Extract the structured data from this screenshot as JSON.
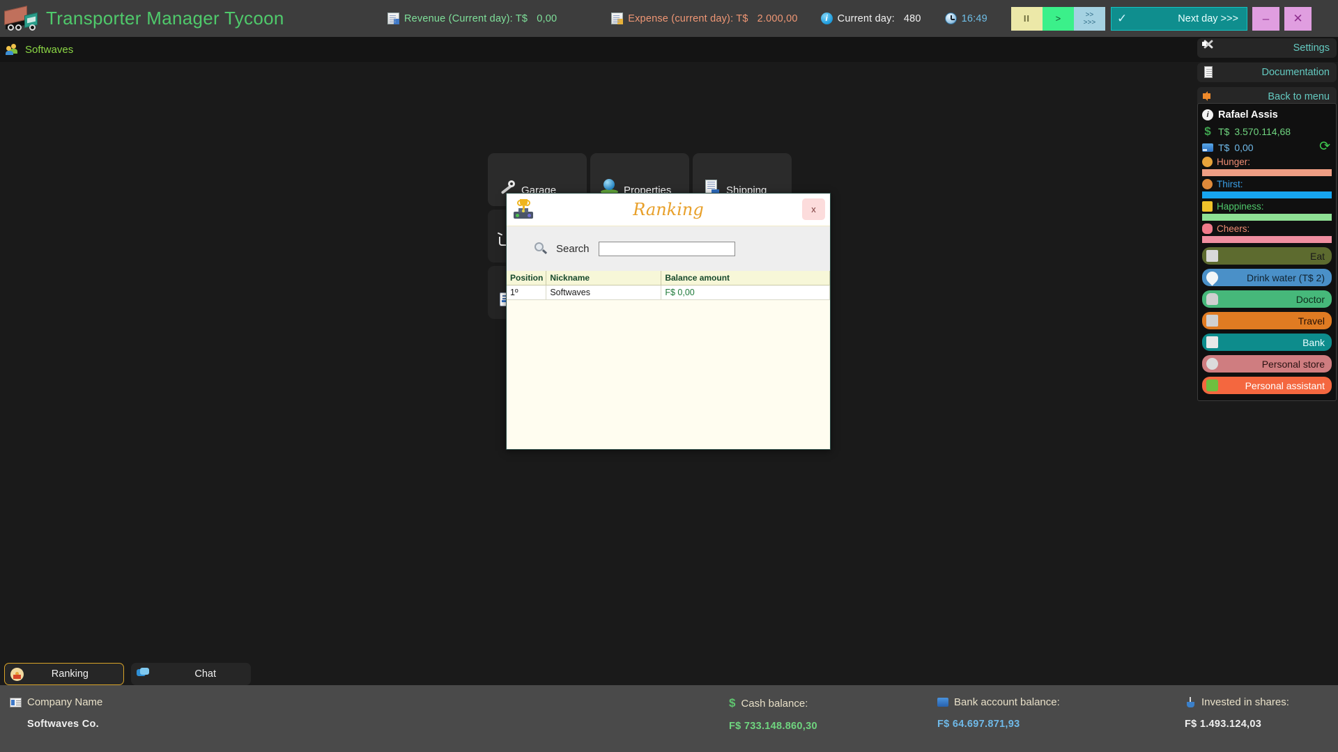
{
  "topbar": {
    "app_title": "Transporter Manager Tycoon",
    "revenue_label": "Revenue (Current day): T$",
    "revenue_value": "0,00",
    "expense_label": "Expense (current day): T$",
    "expense_value": "2.000,00",
    "current_day_label": "Current day:",
    "current_day_value": "480",
    "clock_value": "16:49",
    "pause_label": "II",
    "play_label": ">",
    "ff_label_1": ">>",
    "ff_label_2": ">>>",
    "next_day_label": "Next day >>>",
    "next_day_check": "✓",
    "minimize_label": "–",
    "close_label": "✕"
  },
  "playerbar": {
    "nickname": "Softwaves"
  },
  "cards": [
    {
      "label": "Garage",
      "icon": "wrench-icon"
    },
    {
      "label": "Properties",
      "icon": "globe-icon"
    },
    {
      "label": "Shipping",
      "icon": "shipping-doc-icon"
    },
    {
      "label": "",
      "icon": "cart-icon"
    },
    {
      "label": "",
      "icon": "list-icon"
    }
  ],
  "right_menu": [
    {
      "label": "Settings",
      "icon": "tools-icon"
    },
    {
      "label": "Documentation",
      "icon": "page-icon"
    },
    {
      "label": "Back to menu",
      "icon": "back-arrow-icon"
    }
  ],
  "player": {
    "name": "Rafael Assis",
    "cash_label": "T$",
    "cash_value": "3.570.114,68",
    "card_label": "T$",
    "card_value": "0,00",
    "refresh_icon": "⟳",
    "needs": [
      {
        "label": "Hunger:",
        "color": "#ef9e84",
        "pct": 100
      },
      {
        "label": "Thirst:",
        "color": "#17a5f0",
        "pct": 100
      },
      {
        "label": "Happiness:",
        "color": "#8ee094",
        "pct": 100
      },
      {
        "label": "Cheers:",
        "color": "#f08fa0",
        "pct": 100
      }
    ],
    "actions": [
      {
        "label": "Eat",
        "class": "b-eat",
        "icon": "food-icon"
      },
      {
        "label": "Drink water (T$ 2)",
        "class": "b-water",
        "icon": "water-drop-icon"
      },
      {
        "label": "Doctor",
        "class": "b-doctor",
        "icon": "doctor-icon"
      },
      {
        "label": "Travel",
        "class": "b-travel",
        "icon": "luggage-icon"
      },
      {
        "label": "Bank",
        "class": "b-bank",
        "icon": "bank-icon"
      },
      {
        "label": "Personal store",
        "class": "b-store",
        "icon": "coin-icon"
      },
      {
        "label": "Personal assistant",
        "class": "b-assist",
        "icon": "assistant-icon"
      }
    ]
  },
  "tabs": [
    {
      "label": "Ranking",
      "icon": "podium-icon",
      "active": true
    },
    {
      "label": "Chat",
      "icon": "chat-icon",
      "active": false
    }
  ],
  "dialog": {
    "title": "Ranking",
    "title_icon": "trophy-podium-icon",
    "close_label": "x",
    "search_label": "Search",
    "search_value": "",
    "search_placeholder": "",
    "columns": [
      "Position",
      "Nickname",
      "Balance amount"
    ],
    "rows": [
      {
        "position": "1º",
        "nickname": "Softwaves",
        "balance": "F$  0,00"
      }
    ]
  },
  "footer": {
    "company_name_label": "Company Name",
    "company_name_value": "Softwaves Co.",
    "cash_balance_label": "Cash balance:",
    "cash_balance_value": "F$  733.148.860,30",
    "bank_balance_label": "Bank account balance:",
    "bank_balance_value": "F$  64.697.871,93",
    "shares_label": "Invested in shares:",
    "shares_value": "F$  1.493.124,03"
  }
}
